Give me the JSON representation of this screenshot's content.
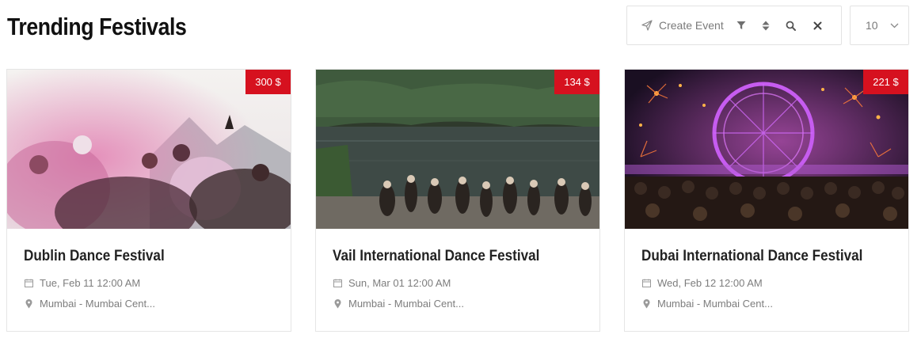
{
  "header": {
    "title": "Trending Festivals",
    "create_event_label": "Create Event",
    "per_page_value": "10"
  },
  "icons": {
    "create": "send-icon",
    "filter": "filter-icon",
    "sort": "sort-icon",
    "search": "search-icon",
    "clear": "close-icon",
    "dropdown": "chevron-down-icon",
    "date": "calendar-icon",
    "location": "map-marker-icon"
  },
  "colors": {
    "price_badge": "#d6111f",
    "meta_text": "#7d7d7d",
    "border": "#e5e5e5"
  },
  "events": [
    {
      "title": "Dublin Dance Festival",
      "price": "300 $",
      "date": "Tue, Feb 11 12:00 AM",
      "location": "Mumbai - Mumbai Cent..."
    },
    {
      "title": "Vail International Dance Festival",
      "price": "134 $",
      "date": "Sun, Mar 01 12:00 AM",
      "location": "Mumbai - Mumbai Cent..."
    },
    {
      "title": "Dubai International Dance Festival",
      "price": "221 $",
      "date": "Wed, Feb 12 12:00 AM",
      "location": "Mumbai - Mumbai Cent..."
    }
  ]
}
